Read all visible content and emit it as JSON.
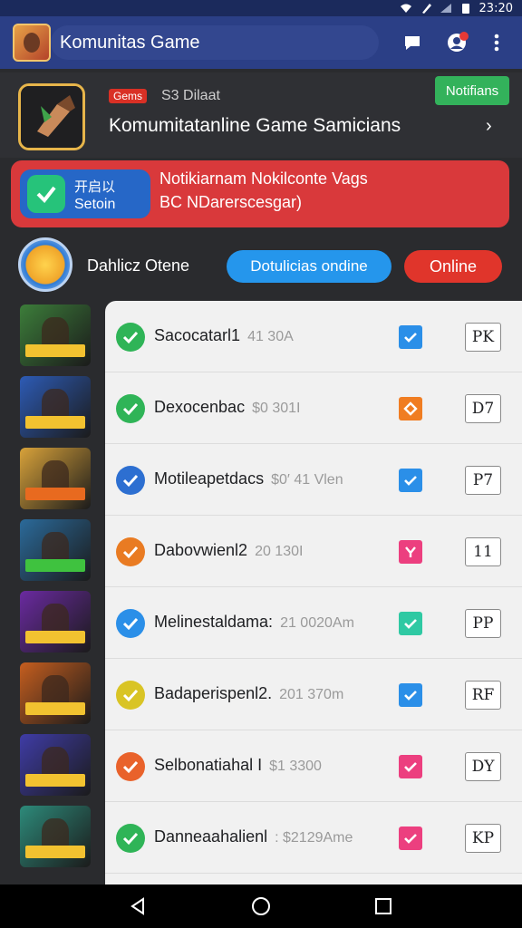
{
  "status_bar": {
    "time": "23:20",
    "icons": [
      "wifi-icon",
      "no-sim-icon",
      "signal-icon",
      "battery-icon"
    ]
  },
  "app_bar": {
    "title": "Komunitas Game",
    "icons": [
      "chat-icon",
      "profile-badge-icon",
      "more-vert-icon"
    ]
  },
  "card": {
    "badge": "Gems",
    "subtitle": "S3 Dilaat",
    "notif_button": "Notifians",
    "title": "Komumitatanline Game Samicians"
  },
  "alert": {
    "badge_line1": "开启以",
    "badge_line2": "Setoin",
    "line1": "Notikiarnam Nokilconte Vags",
    "line2": "BC NDarerscesgar)"
  },
  "profile": {
    "name": "Dahlicz Otene",
    "pill_blue": "Dotulicias ondine",
    "pill_red": "Online"
  },
  "list": [
    {
      "name": "Sacocatarl1",
      "meta": "41 30A",
      "status_color": "#2fb457",
      "sq_color": "#2b8fe8",
      "sq_icon": "check",
      "code": "PK"
    },
    {
      "name": "Dexocenbac",
      "meta": "$0 301I",
      "status_color": "#2fb457",
      "sq_color": "#f07d22",
      "sq_icon": "diamond",
      "code": "D7"
    },
    {
      "name": "Motileapetdacs",
      "meta": "$0′ 41 Vlen",
      "status_color": "#2d6fd1",
      "sq_color": "#2b8fe8",
      "sq_icon": "check",
      "code": "P7"
    },
    {
      "name": "Dabovwienl2",
      "meta": "20 130I",
      "status_color": "#e97b22",
      "sq_color": "#ec3f7f",
      "sq_icon": "y",
      "code": "11"
    },
    {
      "name": "Melinestaldama:",
      "meta": "21 0020Am",
      "status_color": "#2b8fe8",
      "sq_color": "#2fc9a3",
      "sq_icon": "check",
      "code": "PP"
    },
    {
      "name": "Badaperispenl2.",
      "meta": "201 370m",
      "status_color": "#d9c425",
      "sq_color": "#2b8fe8",
      "sq_icon": "check",
      "code": "RF"
    },
    {
      "name": "Selbonatiahal I",
      "meta": "$1 3300",
      "status_color": "#e9622b",
      "sq_color": "#ec3f7f",
      "sq_icon": "check",
      "code": "DY"
    },
    {
      "name": "Danneaahalienl",
      "meta": ": $2129Ame",
      "status_color": "#2fb457",
      "sq_color": "#ec3f7f",
      "sq_icon": "check",
      "code": "KP"
    }
  ],
  "thumbnails": [
    {
      "icon": "game-thumbnail-icon",
      "bg": "#3c7d3a",
      "accent": "#f2c230"
    },
    {
      "icon": "game-thumbnail-icon",
      "bg": "#2d5bb5",
      "accent": "#f2c230"
    },
    {
      "icon": "game-thumbnail-icon",
      "bg": "#d8a23a",
      "accent": "#e86a1f"
    },
    {
      "icon": "game-thumbnail-icon",
      "bg": "#2b6a9a",
      "accent": "#3fc23f"
    },
    {
      "icon": "game-thumbnail-icon",
      "bg": "#6a2aa0",
      "accent": "#f2c230"
    },
    {
      "icon": "game-thumbnail-icon",
      "bg": "#c55e1f",
      "accent": "#f2c230"
    },
    {
      "icon": "game-thumbnail-icon",
      "bg": "#3f3ca6",
      "accent": "#f2c230"
    },
    {
      "icon": "game-thumbnail-icon",
      "bg": "#2d8a7a",
      "accent": "#f2c230"
    }
  ],
  "nav": {
    "icons": [
      "back-icon",
      "home-icon",
      "recents-icon"
    ]
  }
}
